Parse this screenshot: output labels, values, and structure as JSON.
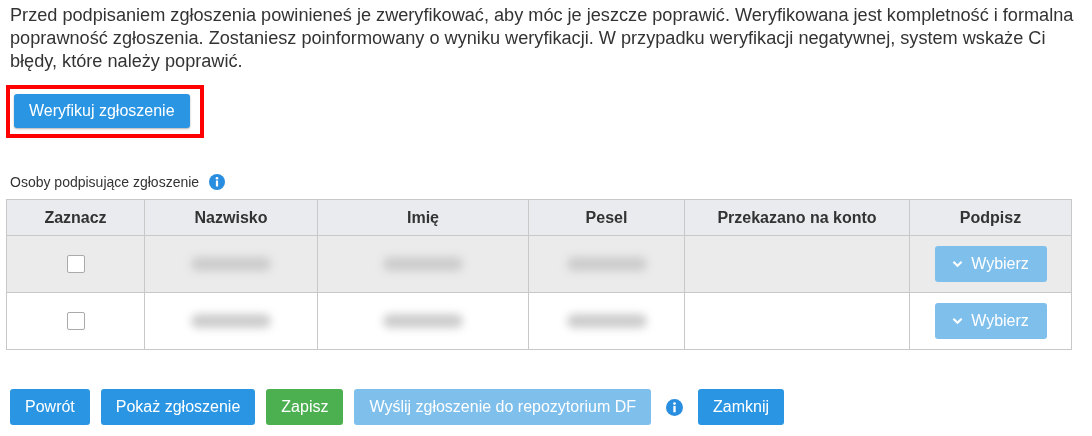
{
  "intro": "Przed podpisaniem zgłoszenia powinieneś je zweryfikować, aby móc je jeszcze poprawić. Weryfikowana jest kompletność i formalna poprawność zgłoszenia. Zostaniesz poinformowany o wyniku weryfikacji. W przypadku weryfikacji negatywnej, system wskaże Ci błędy, które należy poprawić.",
  "verify_button": {
    "label": "Weryfikuj zgłoszenie",
    "highlighted": true
  },
  "signers": {
    "title": "Osoby podpisujące zgłoszenie",
    "columns": [
      "Zaznacz",
      "Nazwisko",
      "Imię",
      "Pesel",
      "Przekazano na konto",
      "Podpisz"
    ],
    "rows": [
      {
        "checked": false,
        "sign_button": {
          "label": "Wybierz",
          "disabled": true
        }
      },
      {
        "checked": false,
        "sign_button": {
          "label": "Wybierz",
          "disabled": true
        }
      }
    ]
  },
  "footer_buttons": [
    {
      "kind": "primary",
      "label": "Powrót"
    },
    {
      "kind": "primary",
      "label": "Pokaż zgłoszenie"
    },
    {
      "kind": "success",
      "label": "Zapisz"
    },
    {
      "kind": "disabled",
      "label": "Wyślij zgłoszenie do repozytorium DF"
    },
    {
      "kind": "info"
    },
    {
      "kind": "primary",
      "label": "Zamknij"
    }
  ]
}
